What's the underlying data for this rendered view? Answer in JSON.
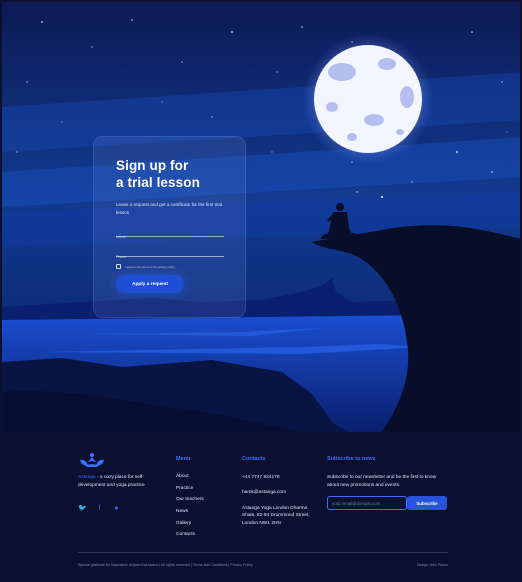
{
  "signup": {
    "title_line1": "Sign up for",
    "title_line2": "a trial lesson",
    "subtitle": "Leave a request and get a certificate for the first trial lesson",
    "name_placeholder": "Name",
    "phone_placeholder": "Phone",
    "agree_text": "I agree to the terms of the privacy policy",
    "apply_label": "Apply a request"
  },
  "brand": {
    "name": "Astanga",
    "tagline": " - a cozy place for self-development and yoga practice"
  },
  "socials": [
    {
      "icon": "twitter-icon",
      "glyph": "🐦"
    },
    {
      "icon": "facebook-icon",
      "glyph": "f"
    },
    {
      "icon": "message-icon",
      "glyph": "●"
    }
  ],
  "menu": {
    "title": "Menu",
    "items": [
      "About",
      "Practice",
      "Our teachers",
      "News",
      "Gallery",
      "Contacts"
    ]
  },
  "contacts": {
    "title": "Contacts",
    "phone": "+44 7747 824178",
    "email": "hamk@astanga.com",
    "address": "Astanga Yoga London Dharma Shala, 92-94 Drummond Street, London NW1 2HN"
  },
  "subscribe": {
    "title": "Subscribe to news",
    "text": "Subscribe to our newsletter and be the first to know about new promotions and events.",
    "email_placeholder": "your.email@domain.com",
    "button_label": "Subscribe"
  },
  "bottom": {
    "left": "Special gratitude for inspiration: Artyom Kashkatov | All rights reserved | Terms and Conditions | Privacy Policy",
    "right": "Design: Alex Parlov"
  },
  "colors": {
    "accent": "#3d6fff",
    "button": "#1f4fd6",
    "background": "#0b1030"
  }
}
